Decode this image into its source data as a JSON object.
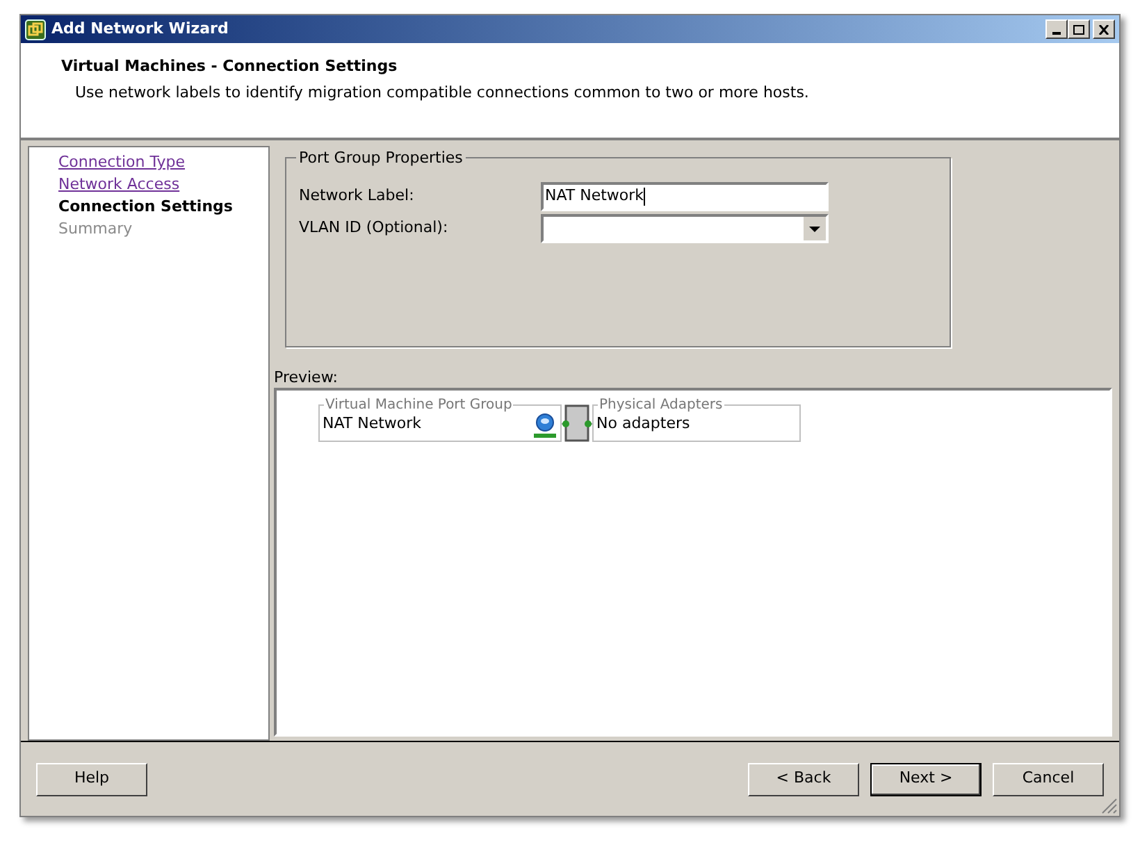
{
  "window": {
    "title": "Add Network Wizard"
  },
  "header": {
    "title": "Virtual Machines - Connection Settings",
    "description": "Use network labels to identify migration compatible connections common to two or more hosts."
  },
  "steps": [
    {
      "label": "Connection Type",
      "kind": "visited",
      "selected": false
    },
    {
      "label": "Network Access",
      "kind": "visited",
      "selected": false
    },
    {
      "label": "Connection Settings",
      "kind": "current",
      "selected": true
    },
    {
      "label": "Summary",
      "kind": "pending",
      "selected": false
    }
  ],
  "port_group_properties": {
    "title": "Port Group Properties",
    "fields": [
      {
        "label": "Network Label:",
        "kind": "text",
        "value": "NAT Network"
      },
      {
        "label": "VLAN ID (Optional):",
        "kind": "dropdown"
      }
    ]
  },
  "preview": {
    "label": "Preview:",
    "port_group": {
      "title": "Virtual Machine Port Group",
      "name": "NAT Network"
    },
    "adapters": {
      "title": "Physical Adapters",
      "text": "No adapters"
    }
  },
  "buttons_left": [
    {
      "label": "Help",
      "default": false
    }
  ],
  "buttons_right": [
    {
      "label": "< Back",
      "default": false
    },
    {
      "label": "Next >",
      "default": true
    },
    {
      "label": "Cancel",
      "default": false
    }
  ]
}
